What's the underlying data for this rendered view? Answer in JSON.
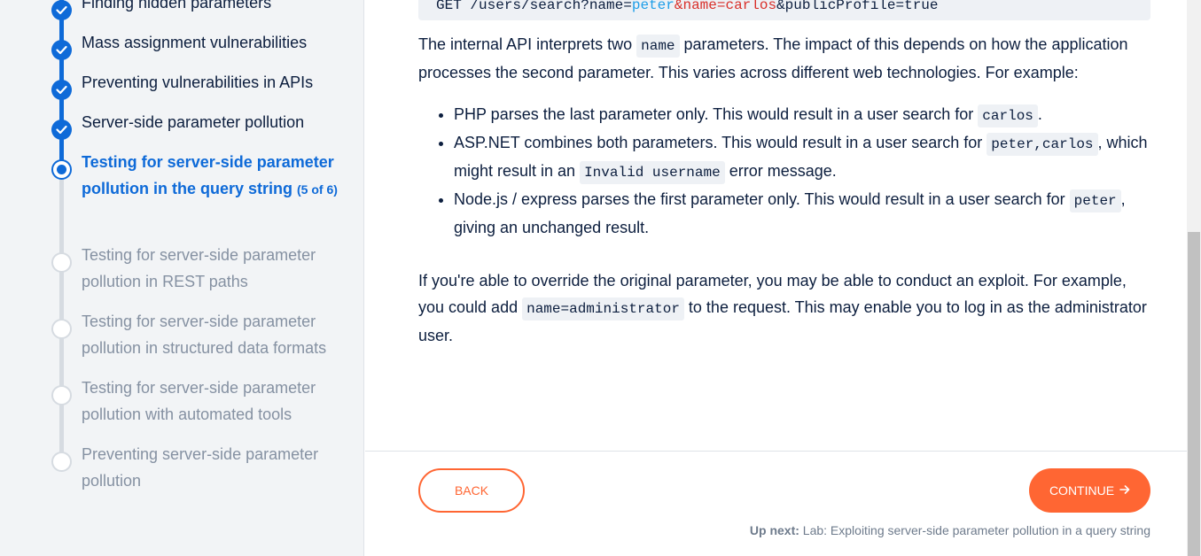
{
  "sidebar": {
    "steps": [
      {
        "label": "Finding hidden parameters",
        "state": "done"
      },
      {
        "label": "Mass assignment vulnerabilities",
        "state": "done"
      },
      {
        "label": "Preventing vulnerabilities in APIs",
        "state": "done"
      },
      {
        "label": "Server-side parameter pollution",
        "state": "done"
      },
      {
        "label": "Testing for server-side parameter pollution in the query string",
        "state": "current",
        "count": "(5 of 6)"
      },
      {
        "label": "Testing for server-side parameter pollution in REST paths",
        "state": "todo"
      },
      {
        "label": "Testing for server-side parameter pollution in structured data formats",
        "state": "todo"
      },
      {
        "label": "Testing for server-side parameter pollution with automated tools",
        "state": "todo"
      },
      {
        "label": "Preventing server-side parameter pollution",
        "state": "todo"
      }
    ]
  },
  "code_example": {
    "prefix": "GET /users/search?name=",
    "value": "peter",
    "injected": "&name=carlos",
    "suffix": "&publicProfile=true"
  },
  "content": {
    "intro_1": "The internal API interprets two ",
    "intro_code": "name",
    "intro_2": " parameters. The impact of this depends on how the application processes the second parameter. This varies across different web technologies. For example:",
    "bullets": [
      {
        "t1": "PHP parses the last parameter only. This would result in a user search for ",
        "c1": "carlos",
        "t2": "."
      },
      {
        "t1": "ASP.NET combines both parameters. This would result in a user search for ",
        "c1": "peter,carlos",
        "t2": ", which might result in an ",
        "c2": "Invalid username",
        "t3": " error message."
      },
      {
        "t1": "Node.js / express parses the first parameter only. This would result in a user search for ",
        "c1": "peter",
        "t2": ", giving an unchanged result."
      }
    ],
    "para2_1": "If you're able to override the original parameter, you may be able to conduct an exploit. For example, you could add ",
    "para2_code": "name=administrator",
    "para2_2": " to the request. This may enable you to log in as the administrator user."
  },
  "footer": {
    "back_label": "BACK",
    "continue_label": "CONTINUE",
    "continue_icon": "arrow-right-icon",
    "up_next_label": "Up next:",
    "up_next_text": "Lab: Exploiting server-side parameter pollution in a query string"
  },
  "colors": {
    "accent_blue": "#0e6ad8",
    "accent_orange": "#ff6633",
    "text_dark": "#0c1e3e",
    "text_muted": "#8591a2"
  }
}
